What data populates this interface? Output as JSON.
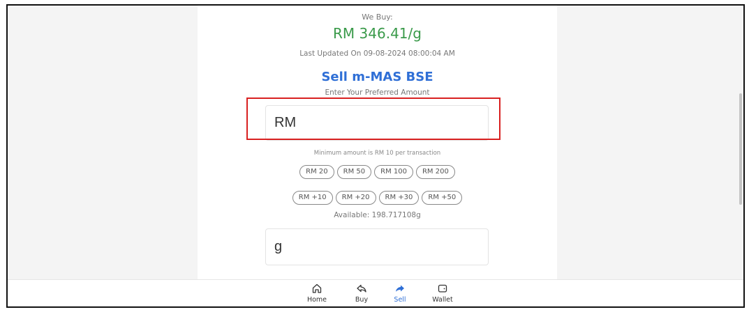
{
  "rate": {
    "label": "We Buy:",
    "price": "RM 346.41/g",
    "updated": "Last Updated On 09-08-2024 08:00:04 AM"
  },
  "form": {
    "title": "Sell m-MAS BSE",
    "subtitle": "Enter Your Preferred Amount",
    "amount_placeholder": "RM",
    "min_note": "Minimum amount is RM 10 per transaction",
    "quick_amounts": [
      "RM 20",
      "RM 50",
      "RM 100",
      "RM 200"
    ],
    "increments": [
      "RM +10",
      "RM +20",
      "RM +30",
      "RM +50"
    ],
    "available": "Available: 198.717108g",
    "gram_placeholder": "g"
  },
  "nav": {
    "items": [
      {
        "label": "Home",
        "icon": "home-icon"
      },
      {
        "label": "Buy",
        "icon": "share-icon"
      },
      {
        "label": "Sell",
        "icon": "forward-arrow-icon",
        "active": true
      },
      {
        "label": "Wallet",
        "icon": "wallet-icon"
      }
    ]
  },
  "colors": {
    "price": "#3a9a4a",
    "accent": "#2f6fd6",
    "highlight": "#d92020"
  }
}
